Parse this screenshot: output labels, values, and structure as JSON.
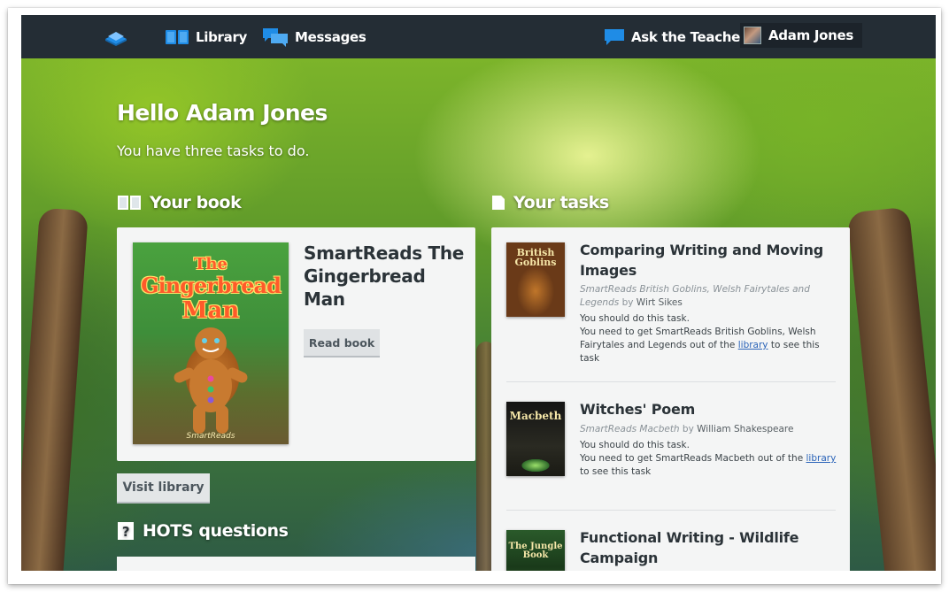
{
  "nav": {
    "library_label": "Library",
    "messages_label": "Messages",
    "ask_teacher_label": "Ask the Teacher",
    "user_name": "Adam Jones"
  },
  "greeting": {
    "title": "Hello Adam Jones",
    "subtitle": "You have three tasks to do."
  },
  "your_book": {
    "heading": "Your book",
    "title": "SmartReads The Gingerbread Man",
    "cover_title_line1": "The",
    "cover_title_line2": "Gingerbread",
    "cover_title_line3": "Man",
    "cover_brand": "SmartReads",
    "read_button": "Read book"
  },
  "visit_library_button": "Visit library",
  "hots": {
    "heading": "HOTS questions"
  },
  "your_tasks": {
    "heading": "Your tasks",
    "tasks": [
      {
        "title": "Comparing Writing and Moving Images",
        "book_italic": "SmartReads British Goblins, Welsh Fairytales and Legends",
        "author_prefix": " by ",
        "author": "Wirt Sikes",
        "status": "You should do this task.",
        "need_prefix": "You need to get SmartReads British Goblins, Welsh Fairytales and Legends out of the ",
        "link": "library",
        "need_suffix": " to see this task",
        "thumb_title": "British Goblins"
      },
      {
        "title": "Witches' Poem",
        "book_italic": "SmartReads Macbeth",
        "author_prefix": " by ",
        "author": "William Shakespeare",
        "status": "You should do this task.",
        "need_prefix": "You need to get SmartReads Macbeth out of the ",
        "link": "library",
        "need_suffix": " to see this task",
        "thumb_title": "Macbeth"
      },
      {
        "title": "Functional Writing - Wildlife Campaign",
        "thumb_title": "The Jungle Book"
      }
    ]
  },
  "colors": {
    "navbar": "#242d35",
    "card": "#f4f5f5",
    "link": "#2a63b8",
    "nav_icon_blue": "#1f8ce6"
  },
  "icons": {
    "logo": "book-logo-icon",
    "library": "book-open-icon",
    "messages": "chat-bubbles-icon",
    "ask_teacher": "speech-bubble-icon",
    "your_book": "open-book-icon",
    "your_tasks": "document-icon",
    "hots": "question-box-icon"
  }
}
